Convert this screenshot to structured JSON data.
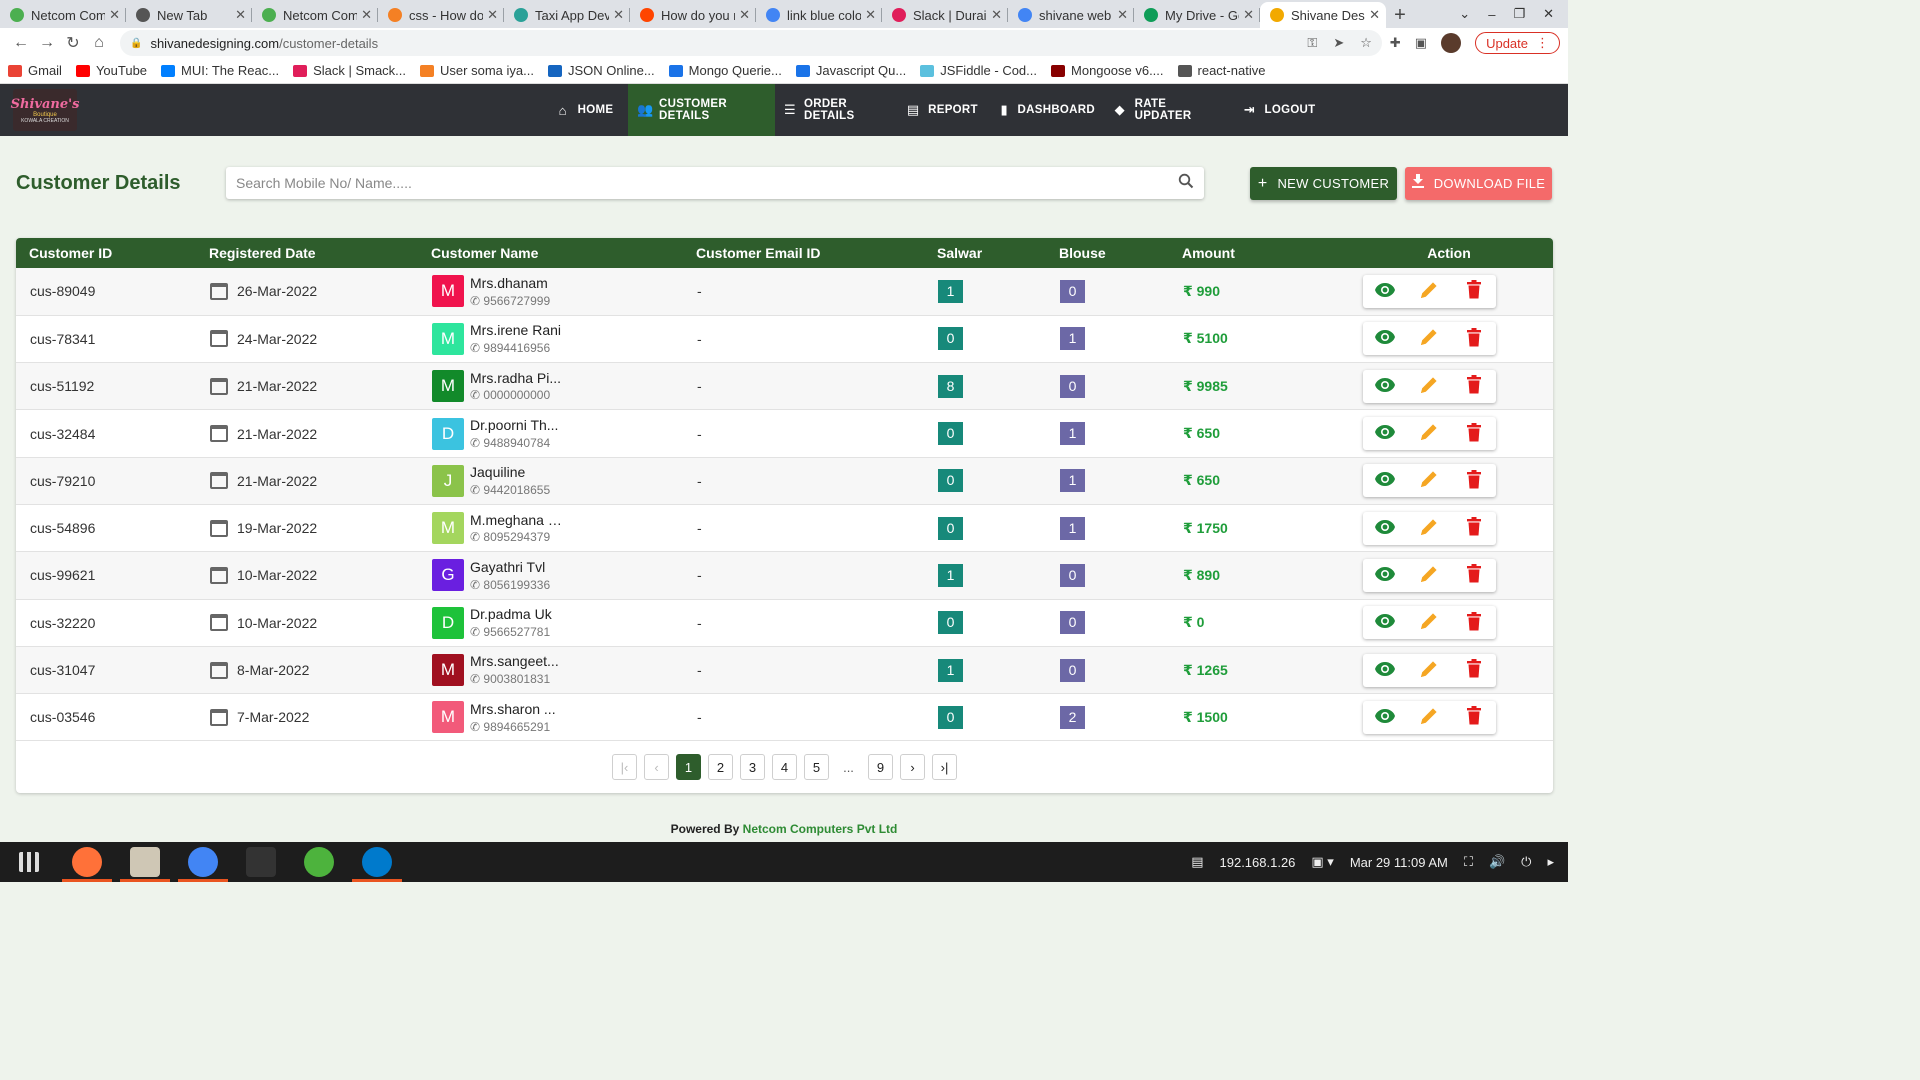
{
  "browser": {
    "tabs": [
      {
        "label": "Netcom Com",
        "color": "#4caf50"
      },
      {
        "label": "New Tab",
        "color": "#555555"
      },
      {
        "label": "Netcom Com",
        "color": "#4caf50"
      },
      {
        "label": "css - How do",
        "color": "#f48024"
      },
      {
        "label": "Taxi App Dev",
        "color": "#2aa198"
      },
      {
        "label": "How do you r",
        "color": "#ff4500"
      },
      {
        "label": "link blue colo",
        "color": "#4285f4"
      },
      {
        "label": "Slack | Durai",
        "color": "#e01e5a"
      },
      {
        "label": "shivane web",
        "color": "#4285f4"
      },
      {
        "label": "My Drive - Go",
        "color": "#0f9d58"
      },
      {
        "label": "Shivane Desi",
        "color": "#f2a900"
      }
    ],
    "url_host": "shivanedesigning.com",
    "url_path": "/customer-details",
    "update_label": "Update",
    "bookmarks": [
      {
        "label": "Gmail",
        "color": "#ea4335"
      },
      {
        "label": "YouTube",
        "color": "#ff0000"
      },
      {
        "label": "MUI: The Reac...",
        "color": "#007fff"
      },
      {
        "label": "Slack | Smack...",
        "color": "#e01e5a"
      },
      {
        "label": "User soma iya...",
        "color": "#f48024"
      },
      {
        "label": "JSON Online...",
        "color": "#1565c0"
      },
      {
        "label": "Mongo Querie...",
        "color": "#1a73e8"
      },
      {
        "label": "Javascript Qu...",
        "color": "#1a73e8"
      },
      {
        "label": "JSFiddle - Cod...",
        "color": "#5bc0de"
      },
      {
        "label": "Mongoose v6....",
        "color": "#880000"
      },
      {
        "label": "react-native",
        "color": "#555555"
      }
    ]
  },
  "nav": {
    "logo": {
      "main": "Shivane's",
      "sub": "Boutique",
      "sub2": "KOWALA CREATION"
    },
    "items": [
      {
        "label": "HOME",
        "icon": "home-icon",
        "glyph": "⌂"
      },
      {
        "label": "CUSTOMER DETAILS",
        "icon": "people-icon",
        "glyph": "👥"
      },
      {
        "label": "ORDER DETAILS",
        "icon": "list-icon",
        "glyph": "☰"
      },
      {
        "label": "REPORT",
        "icon": "document-icon",
        "glyph": "▤"
      },
      {
        "label": "DASHBOARD",
        "icon": "bar-chart-icon",
        "glyph": "▮"
      },
      {
        "label": "RATE UPDATER",
        "icon": "tag-icon",
        "glyph": "◆"
      },
      {
        "label": "LOGOUT",
        "icon": "logout-icon",
        "glyph": "⇥"
      }
    ],
    "active_index": 1
  },
  "page": {
    "title": "Customer Details",
    "search_placeholder": "Search Mobile No/ Name.....",
    "new_customer_label": "NEW CUSTOMER",
    "download_label": "DOWNLOAD FILE"
  },
  "table": {
    "headers": [
      "Customer ID",
      "Registered Date",
      "Customer Name",
      "Customer Email ID",
      "Salwar",
      "Blouse",
      "Amount",
      "Action"
    ],
    "rows": [
      {
        "id": "cus-89049",
        "date": "26-Mar-2022",
        "initial": "M",
        "avatar_color": "#f0134d",
        "name": "Mrs.dhanam",
        "phone": "9566727999",
        "email": "-",
        "salwar": "1",
        "blouse": "0",
        "amount": "₹ 990"
      },
      {
        "id": "cus-78341",
        "date": "24-Mar-2022",
        "initial": "M",
        "avatar_color": "#2ee59d",
        "name": "Mrs.irene Rani",
        "phone": "9894416956",
        "email": "-",
        "salwar": "0",
        "blouse": "1",
        "amount": "₹ 5100"
      },
      {
        "id": "cus-51192",
        "date": "21-Mar-2022",
        "initial": "M",
        "avatar_color": "#128a2a",
        "name": "Mrs.radha Pi...",
        "phone": "0000000000",
        "email": "-",
        "salwar": "8",
        "blouse": "0",
        "amount": "₹ 9985"
      },
      {
        "id": "cus-32484",
        "date": "21-Mar-2022",
        "initial": "D",
        "avatar_color": "#3bc3e0",
        "name": "Dr.poorni Th...",
        "phone": "9488940784",
        "email": "-",
        "salwar": "0",
        "blouse": "1",
        "amount": "₹ 650"
      },
      {
        "id": "cus-79210",
        "date": "21-Mar-2022",
        "initial": "J",
        "avatar_color": "#8bc34a",
        "name": "Jaquiline",
        "phone": "9442018655",
        "email": "-",
        "salwar": "0",
        "blouse": "1",
        "amount": "₹ 650"
      },
      {
        "id": "cus-54896",
        "date": "19-Mar-2022",
        "initial": "M",
        "avatar_color": "#a4d65e",
        "name": "M.meghana Fb",
        "phone": "8095294379",
        "email": "-",
        "salwar": "0",
        "blouse": "1",
        "amount": "₹ 1750"
      },
      {
        "id": "cus-99621",
        "date": "10-Mar-2022",
        "initial": "G",
        "avatar_color": "#6a1fe0",
        "name": "Gayathri Tvl",
        "phone": "8056199336",
        "email": "-",
        "salwar": "1",
        "blouse": "0",
        "amount": "₹ 890"
      },
      {
        "id": "cus-32220",
        "date": "10-Mar-2022",
        "initial": "D",
        "avatar_color": "#1ec23a",
        "name": "Dr.padma Uk",
        "phone": "9566527781",
        "email": "-",
        "salwar": "0",
        "blouse": "0",
        "amount": "₹ 0"
      },
      {
        "id": "cus-31047",
        "date": "8-Mar-2022",
        "initial": "M",
        "avatar_color": "#a01020",
        "name": "Mrs.sangeet...",
        "phone": "9003801831",
        "email": "-",
        "salwar": "1",
        "blouse": "0",
        "amount": "₹ 1265"
      },
      {
        "id": "cus-03546",
        "date": "7-Mar-2022",
        "initial": "M",
        "avatar_color": "#f25a7a",
        "name": "Mrs.sharon ...",
        "phone": "9894665291",
        "email": "-",
        "salwar": "0",
        "blouse": "2",
        "amount": "₹ 1500"
      }
    ],
    "action_icons": [
      "eye-icon",
      "pencil-icon",
      "trash-icon"
    ],
    "colors": {
      "view": "#1f8a3a",
      "edit": "#f5a623",
      "delete": "#e41b1b"
    }
  },
  "pagination": {
    "pages": [
      "1",
      "2",
      "3",
      "4",
      "5",
      "...",
      "9"
    ],
    "current": "1",
    "first_icon": "first-page-icon",
    "prev_icon": "chevron-left-icon",
    "next_icon": "chevron-right-icon",
    "last_icon": "last-page-icon"
  },
  "footer": {
    "prefix": "Powered By",
    "brand": "Netcom Computers Pvt Ltd"
  },
  "taskbar": {
    "apps": [
      {
        "name": "app-grid-icon",
        "color": "#dddddd"
      },
      {
        "name": "firefox-icon",
        "color": "#ff7139"
      },
      {
        "name": "files-icon",
        "color": "#cfc7b5"
      },
      {
        "name": "chrome-icon",
        "color": "#4285f4"
      },
      {
        "name": "terminal-icon",
        "color": "#333333"
      },
      {
        "name": "mongodb-compass-icon",
        "color": "#4db33d"
      },
      {
        "name": "vscode-icon",
        "color": "#007acc"
      }
    ],
    "ip": "192.168.1.26",
    "datetime": "Mar 29  11:09 AM"
  },
  "accent": {
    "green": "#2e5d2c",
    "red": "#f46a6a"
  }
}
